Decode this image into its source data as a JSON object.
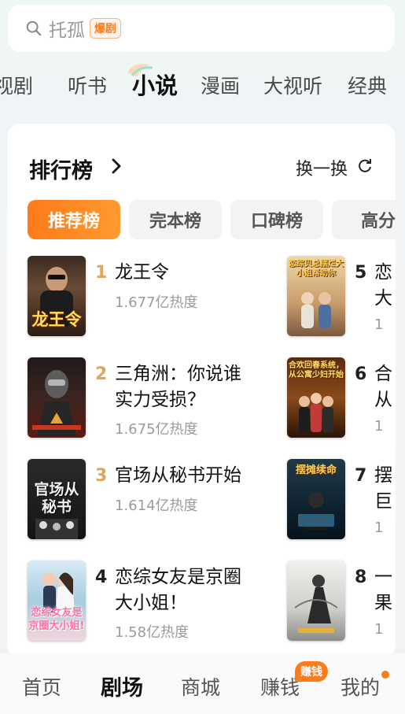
{
  "search": {
    "text": "托孤",
    "badge": "爆剧",
    "icon": "search-icon"
  },
  "channel_tabs": [
    {
      "label": "视剧"
    },
    {
      "label": "听书"
    },
    {
      "label": "小说",
      "active": true
    },
    {
      "label": "漫画"
    },
    {
      "label": "大视听"
    },
    {
      "label": "经典"
    }
  ],
  "ranking": {
    "title": "排行榜",
    "refresh_label": "换一换",
    "filters": [
      {
        "label": "推荐榜",
        "active": true
      },
      {
        "label": "完本榜"
      },
      {
        "label": "口碑榜"
      },
      {
        "label": "高分"
      }
    ],
    "books": [
      {
        "rank": "1",
        "title": "龙王令",
        "heat": "1.677亿热度",
        "cover_text": "龙王令"
      },
      {
        "rank": "2",
        "title": "三角洲：你说谁实力受损？",
        "heat": "1.675亿热度",
        "cover_text": ""
      },
      {
        "rank": "3",
        "title": "官场从秘书开始",
        "heat": "1.614亿热度",
        "cover_text": "官场从秘书"
      },
      {
        "rank": "4",
        "title": "恋综女友是京圈大小姐！",
        "heat": "1.58亿热度",
        "cover_text": "恋综女友是京圈大小姐!"
      },
      {
        "rank": "5",
        "title": "恋",
        "line2": "大",
        "heat": "1",
        "cover_text": "恋综贝总摆烂大小姐帮助你"
      },
      {
        "rank": "6",
        "title": "合",
        "line2": "从",
        "heat": "1",
        "cover_text": "合欢回春系统，从公寓少妇开始"
      },
      {
        "rank": "7",
        "title": "摆",
        "line2": "巨",
        "heat": "1",
        "cover_text": "摆摊续命"
      },
      {
        "rank": "8",
        "title": "一",
        "line2": "果",
        "heat": "1",
        "cover_text": ""
      }
    ]
  },
  "bottom_nav": [
    {
      "label": "首页"
    },
    {
      "label": "剧场",
      "active": true
    },
    {
      "label": "商城"
    },
    {
      "label": "赚钱",
      "badge": "赚钱"
    },
    {
      "label": "我的",
      "dot": true
    }
  ],
  "colors": {
    "accent": "#ff7a1a",
    "rank_gold": "#e0a55a"
  }
}
